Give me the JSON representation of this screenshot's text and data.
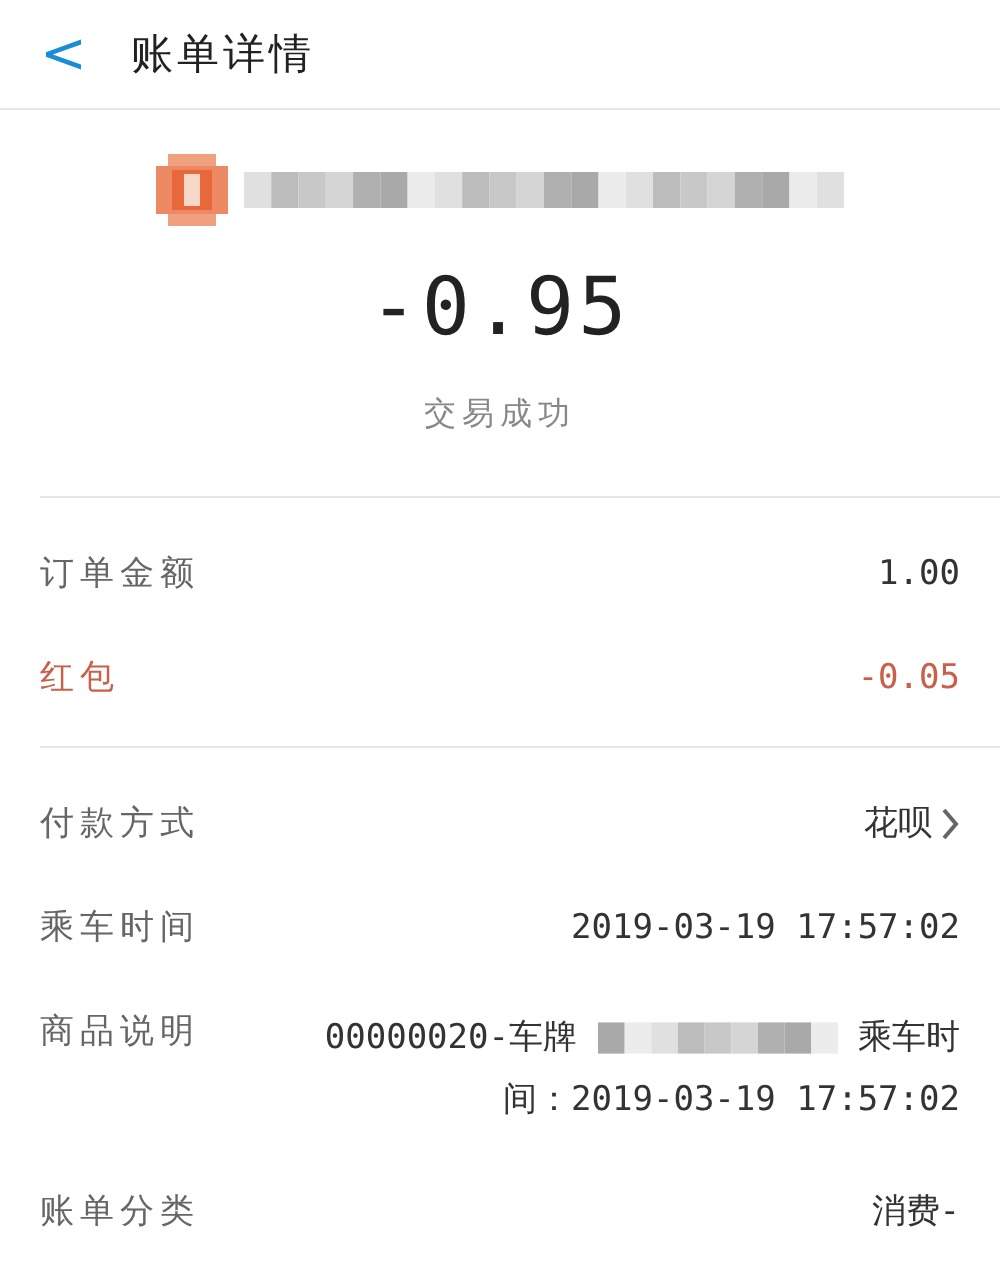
{
  "header": {
    "back": "<",
    "title": "账单详情"
  },
  "merchant": {
    "kind": "redacted"
  },
  "amount": "-0.95",
  "status": "交易成功",
  "sections": [
    {
      "rows": [
        {
          "kind": "plain",
          "label": "订单金额",
          "value": "1.00",
          "color": "#666666"
        },
        {
          "kind": "plain",
          "label": "红包",
          "value": "-0.05",
          "color": "#c9604a"
        }
      ]
    },
    {
      "rows": [
        {
          "kind": "link",
          "label": "付款方式",
          "value": "花呗",
          "color": "#666666"
        },
        {
          "kind": "plain",
          "label": "乘车时间",
          "value": "2019-03-19 17:57:02",
          "color": "#666666"
        },
        {
          "kind": "redacted",
          "label": "商品说明",
          "value": "00000020-车牌",
          "value_after": "乘车时间：2019-03-19 17:57:02",
          "color": "#666666"
        },
        {
          "kind": "plain",
          "label": "账单分类",
          "value": "消费-",
          "color": "#666666"
        }
      ]
    }
  ]
}
